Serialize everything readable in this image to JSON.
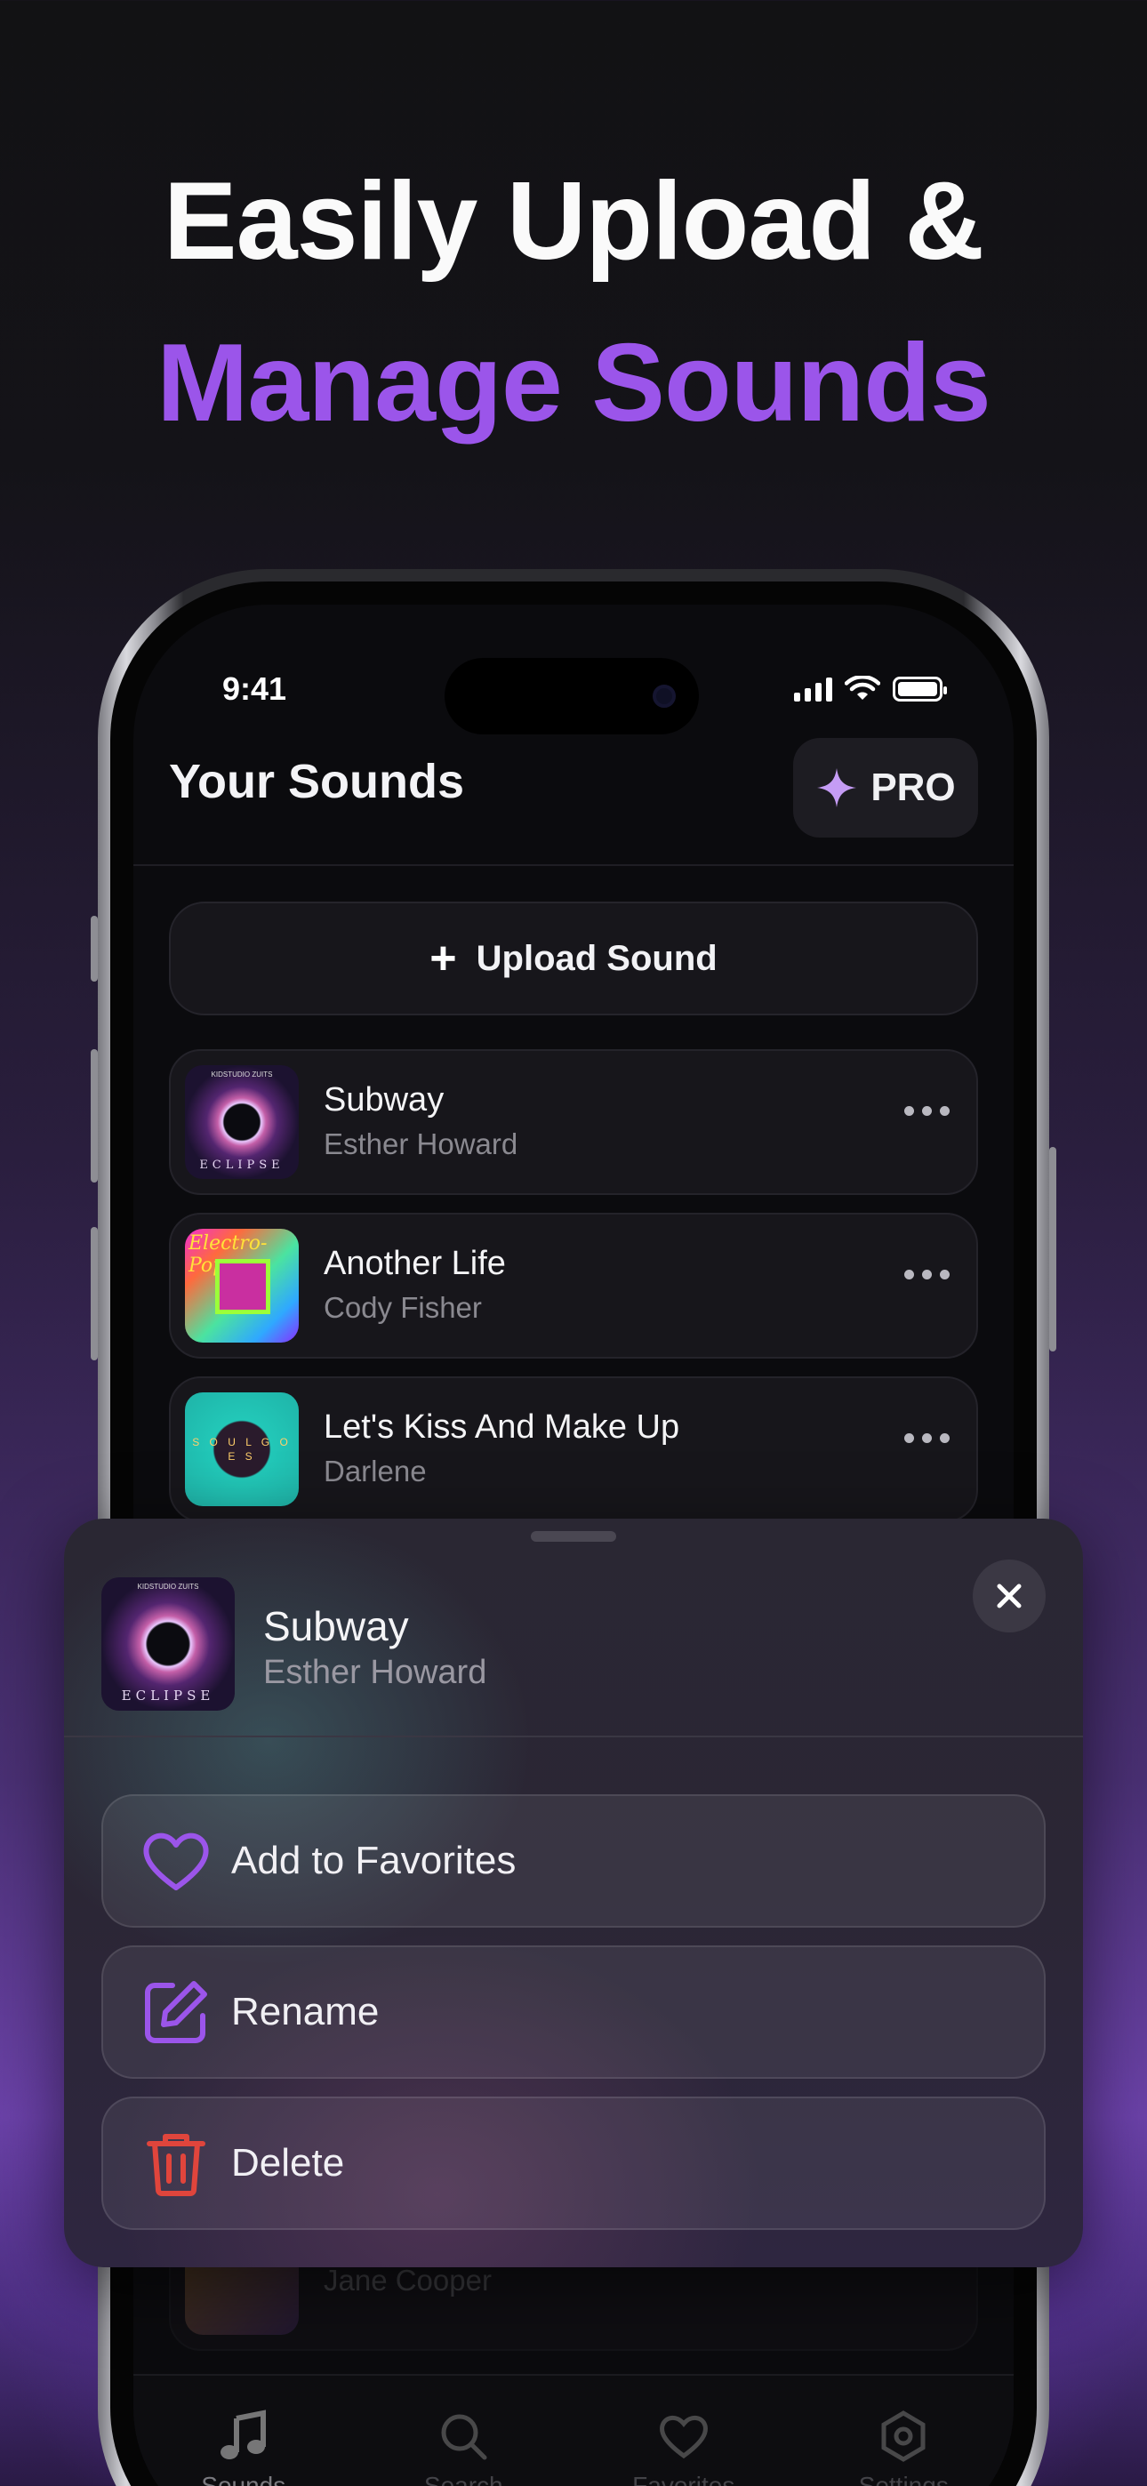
{
  "headline": {
    "line1": "Easily Upload &",
    "line2": "Manage Sounds"
  },
  "status": {
    "time": "9:41"
  },
  "header": {
    "title": "Your Sounds",
    "pro_label": "PRO"
  },
  "upload": {
    "label": "Upload Sound"
  },
  "tracks": [
    {
      "title": "Subway",
      "artist": "Esther Howard",
      "art": "eclipse"
    },
    {
      "title": "Another Life",
      "artist": "Cody Fisher",
      "art": "electro-pop"
    },
    {
      "title": "Let's Kiss And Make Up",
      "artist": "Darlene",
      "art": "soul-goes"
    },
    {
      "title": "",
      "artist": "Jane Cooper",
      "art": "partial"
    }
  ],
  "art_text": {
    "eclipse": "ECLIPSE",
    "eclipse_top": "KIDSTUDIO ZUITS",
    "electro": "Electro-Pop",
    "soul": "S O U L G O E S"
  },
  "tabs": [
    {
      "label": "Sounds",
      "icon": "music-note-icon",
      "active": true
    },
    {
      "label": "Search",
      "icon": "search-icon",
      "active": false
    },
    {
      "label": "Favorites",
      "icon": "heart-icon",
      "active": false
    },
    {
      "label": "Settings",
      "icon": "settings-icon",
      "active": false
    }
  ],
  "sheet": {
    "title": "Subway",
    "artist": "Esther Howard",
    "actions": [
      {
        "label": "Add to Favorites",
        "icon": "heart-icon"
      },
      {
        "label": "Rename",
        "icon": "edit-icon"
      },
      {
        "label": "Delete",
        "icon": "trash-icon"
      }
    ]
  },
  "colors": {
    "accent": "#9b55ea",
    "danger": "#e0453c",
    "background": "#121214"
  }
}
